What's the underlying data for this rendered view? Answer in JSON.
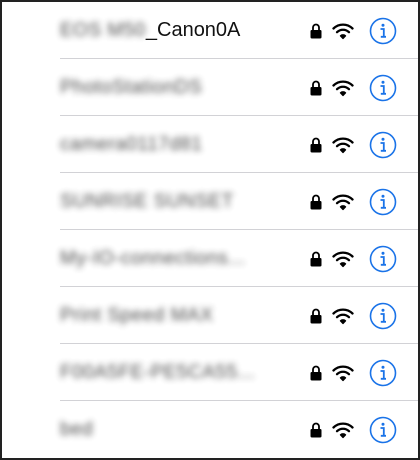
{
  "colors": {
    "accent": "#1a73e8",
    "text": "#111111",
    "separator": "#d2d2d6",
    "border": "#222222"
  },
  "icons": {
    "lock": "lock-icon",
    "wifi": "wifi-icon",
    "info": "info-icon"
  },
  "networks": [
    {
      "name_prefix": "EOS M50",
      "name_suffix": "_Canon0A",
      "secured": true,
      "signal_bars": 3,
      "prefix_blurred": true
    },
    {
      "name": "PhotoStationDS",
      "secured": true,
      "signal_bars": 3,
      "blurred": true
    },
    {
      "name": "camera0117d81",
      "secured": true,
      "signal_bars": 3,
      "blurred": true
    },
    {
      "name": "SUNRISE SUNSET",
      "secured": true,
      "signal_bars": 3,
      "blurred": true
    },
    {
      "name": "My-IO-connections...",
      "secured": true,
      "signal_bars": 3,
      "blurred": true
    },
    {
      "name": "Print Speed MAX",
      "secured": true,
      "signal_bars": 3,
      "blurred": true
    },
    {
      "name": "F00A5FE-PE5CA55...",
      "secured": true,
      "signal_bars": 3,
      "blurred": true
    },
    {
      "name": "bed",
      "secured": true,
      "signal_bars": 3,
      "blurred": true
    }
  ]
}
